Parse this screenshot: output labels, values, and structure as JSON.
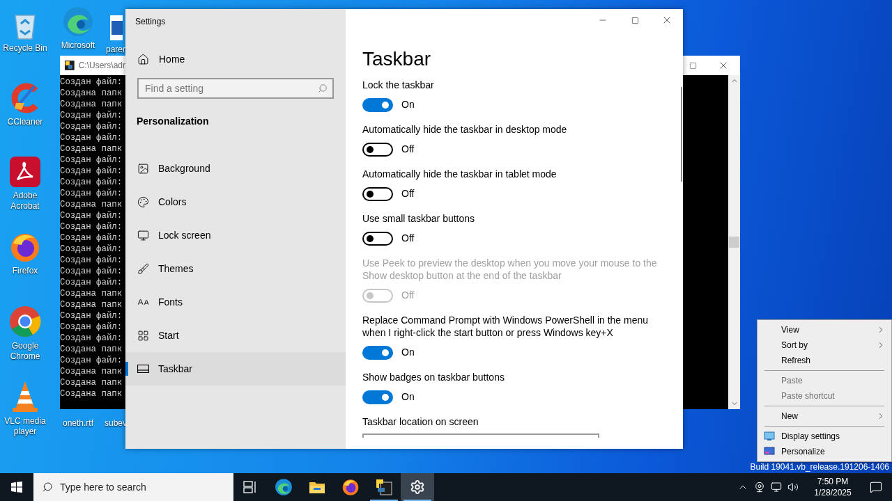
{
  "desktop": {
    "icons": [
      {
        "label": "Recycle Bin",
        "kind": "recycle"
      },
      {
        "label": "Microsoft",
        "kind": "edge"
      },
      {
        "label": "parer",
        "kind": "document"
      },
      {
        "label": "CCleaner",
        "kind": "ccleaner"
      },
      {
        "label": "Adobe Acrobat",
        "kind": "acrobat"
      },
      {
        "label": "Firefox",
        "kind": "firefox"
      },
      {
        "label": "Google Chrome",
        "kind": "chrome"
      },
      {
        "label": "VLC media player",
        "kind": "vlc"
      },
      {
        "label": "oneth.rtf",
        "kind": "file"
      },
      {
        "label": "subev",
        "kind": "file"
      }
    ],
    "build_text": "Build 19041.vb_release.191206-1406"
  },
  "console_window": {
    "title": "C:\\Users\\adr",
    "lines": [
      "Создан файл:",
      "Создана папк",
      "Создана папк",
      "Создан файл:",
      "Создан файл:",
      "Создан файл:",
      "Создана папк",
      "Создан файл:",
      "Создан файл:",
      "Создан файл:",
      "Создан файл:",
      "Создана папк",
      "Создан файл:",
      "Создан файл:",
      "Создан файл:",
      "Создан файл:",
      "Создан файл:",
      "Создан файл:",
      "Создан файл:",
      "Создана папк",
      "Создана папк",
      "Создан файл:",
      "Создан файл:",
      "Создан файл:",
      "Создана папк",
      "Создан файл:",
      "Создана папк",
      "Создана папк",
      "Создана папк"
    ]
  },
  "settings_window": {
    "title": "Settings",
    "home": "Home",
    "search": {
      "placeholder": "Find a setting"
    },
    "section": "Personalization",
    "nav": [
      {
        "label": "Background",
        "kind": "background",
        "selected": false
      },
      {
        "label": "Colors",
        "kind": "colors",
        "selected": false
      },
      {
        "label": "Lock screen",
        "kind": "lockscreen",
        "selected": false
      },
      {
        "label": "Themes",
        "kind": "themes",
        "selected": false
      },
      {
        "label": "Fonts",
        "kind": "fonts",
        "selected": false
      },
      {
        "label": "Start",
        "kind": "start",
        "selected": false
      },
      {
        "label": "Taskbar",
        "kind": "taskbar",
        "selected": true
      }
    ],
    "page_title": "Taskbar",
    "settings": [
      {
        "label": "Lock the taskbar",
        "on": true,
        "state_text": "On",
        "disabled": false
      },
      {
        "label": "Automatically hide the taskbar in desktop mode",
        "on": false,
        "state_text": "Off",
        "disabled": false
      },
      {
        "label": "Automatically hide the taskbar in tablet mode",
        "on": false,
        "state_text": "Off",
        "disabled": false
      },
      {
        "label": "Use small taskbar buttons",
        "on": false,
        "state_text": "Off",
        "disabled": false
      },
      {
        "label": "Use Peek to preview the desktop when you move your mouse to the Show desktop button at the end of the taskbar",
        "on": false,
        "state_text": "Off",
        "disabled": true
      },
      {
        "label": "Replace Command Prompt with Windows PowerShell in the menu when I right-click the start button or press Windows key+X",
        "on": true,
        "state_text": "On",
        "disabled": false
      },
      {
        "label": "Show badges on taskbar buttons",
        "on": true,
        "state_text": "On",
        "disabled": false
      }
    ],
    "subheading": "Taskbar location on screen"
  },
  "context_menu": {
    "items": [
      {
        "kind": "item",
        "label": "View",
        "submenu": true,
        "disabled": false
      },
      {
        "kind": "item",
        "label": "Sort by",
        "submenu": true,
        "disabled": false
      },
      {
        "kind": "item",
        "label": "Refresh",
        "submenu": false,
        "disabled": false
      },
      {
        "kind": "separator"
      },
      {
        "kind": "item",
        "label": "Paste",
        "submenu": false,
        "disabled": true
      },
      {
        "kind": "item",
        "label": "Paste shortcut",
        "submenu": false,
        "disabled": true
      },
      {
        "kind": "separator"
      },
      {
        "kind": "item",
        "label": "New",
        "submenu": true,
        "disabled": false
      },
      {
        "kind": "separator"
      },
      {
        "kind": "display",
        "label": "Display settings",
        "submenu": false,
        "disabled": false
      },
      {
        "kind": "personalize",
        "label": "Personalize",
        "submenu": false,
        "disabled": false
      }
    ]
  },
  "taskbar": {
    "search": {
      "placeholder": "Type here to search"
    },
    "apps": [
      {
        "kind": "taskview",
        "running": false,
        "selected": false
      },
      {
        "kind": "edge",
        "running": false,
        "selected": false
      },
      {
        "kind": "explorer",
        "running": false,
        "selected": false
      },
      {
        "kind": "firefox",
        "running": false,
        "selected": false
      },
      {
        "kind": "python",
        "running": true,
        "selected": false
      },
      {
        "kind": "settings",
        "running": true,
        "selected": true
      }
    ],
    "time": "7:50 PM",
    "date": "1/28/2025"
  }
}
